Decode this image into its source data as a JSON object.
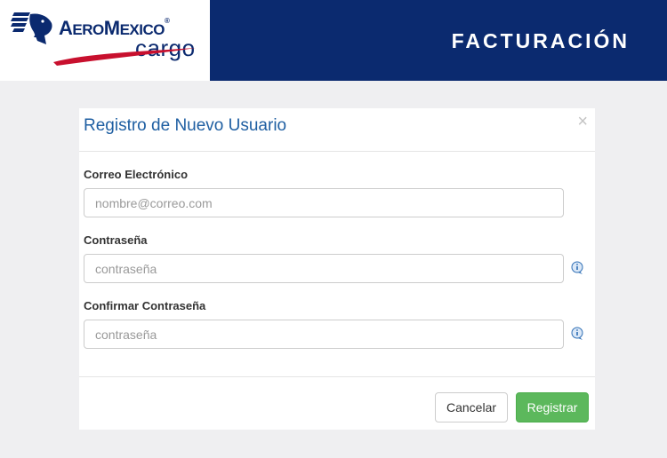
{
  "header": {
    "logo_word_parts": [
      "A",
      "ERO",
      "M",
      "EXICO"
    ],
    "logo_registered": "®",
    "logo_sub": "cargo",
    "title": "FACTURACIÓN",
    "brand_color": "#0b2a6f"
  },
  "modal": {
    "title": "Registro de Nuevo Usuario",
    "close_symbol": "×",
    "fields": [
      {
        "label": "Correo Electrónico",
        "placeholder": "nombre@correo.com",
        "value": ""
      },
      {
        "label": "Contraseña",
        "placeholder": "contraseña",
        "value": "",
        "icon": "info-icon"
      },
      {
        "label": "Confirmar Contraseña",
        "placeholder": "contraseña",
        "value": "",
        "icon": "info-icon"
      }
    ],
    "buttons": {
      "cancel": "Cancelar",
      "submit": "Registrar"
    },
    "colors": {
      "title": "#1f5fa2",
      "submit": "#5cb85c"
    }
  }
}
